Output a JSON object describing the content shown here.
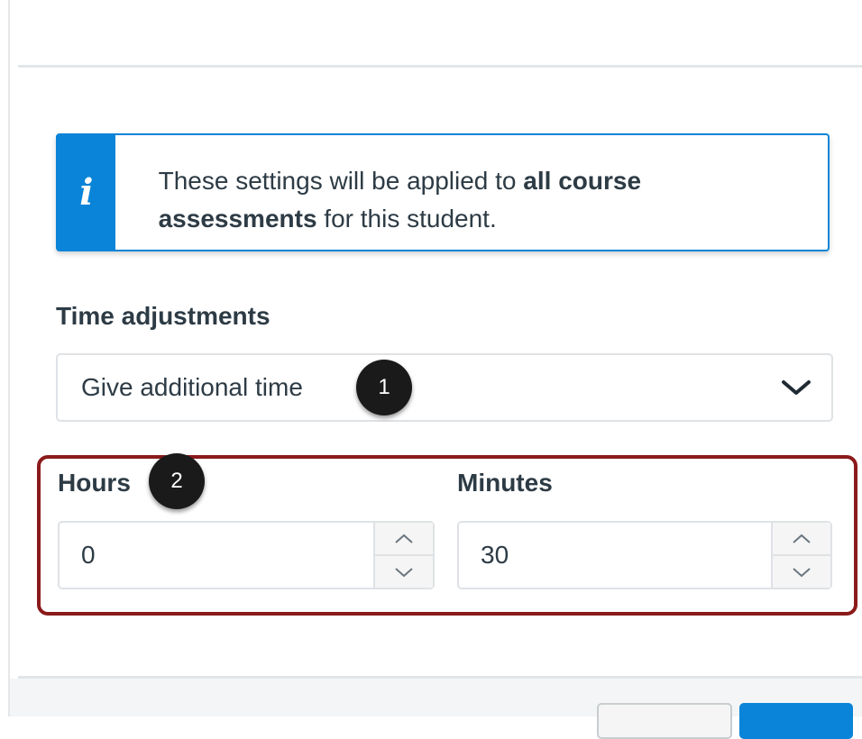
{
  "alert": {
    "icon": "info-icon",
    "icon_glyph": "i",
    "text_before": "These settings will be applied to ",
    "text_bold": "all course assessments",
    "text_after": " for this student."
  },
  "time_adjustments": {
    "label": "Time adjustments",
    "selected": "Give additional time"
  },
  "hours": {
    "label": "Hours",
    "value": "0"
  },
  "minutes": {
    "label": "Minutes",
    "value": "30"
  },
  "callouts": {
    "one": "1",
    "two": "2"
  },
  "colors": {
    "accent": "#0a84d8",
    "highlight": "#8b1a1a",
    "text": "#2d3b45"
  }
}
